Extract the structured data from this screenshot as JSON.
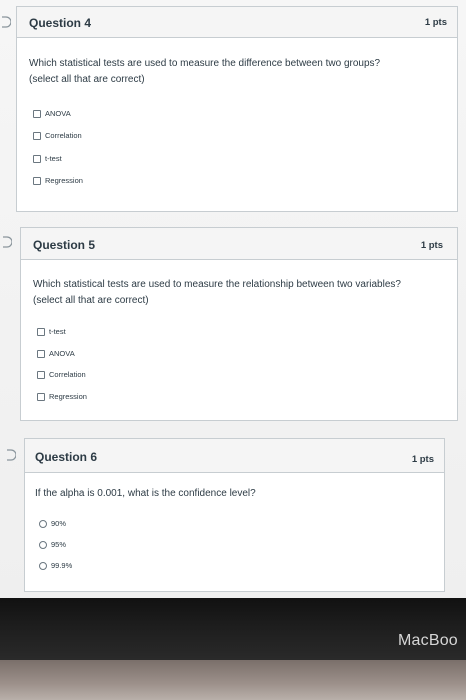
{
  "questions": [
    {
      "title": "Question 4",
      "points": "1 pts",
      "text_line1": "Which statistical tests are used to measure the difference between two groups?",
      "text_line2": "(select all that are correct)",
      "options": [
        "ANOVA",
        "Correlation",
        "t-test",
        "Regression"
      ]
    },
    {
      "title": "Question 5",
      "points": "1 pts",
      "text_line1": "Which statistical tests are used to measure the relationship between two variables?",
      "text_line2": "(select all that are correct)",
      "options": [
        "t-test",
        "ANOVA",
        "Correlation",
        "Regression"
      ]
    },
    {
      "title": "Question 6",
      "points": "1 pts",
      "text_line1": "If the alpha is 0.001, what is the confidence level?",
      "options": [
        "90%",
        "95%",
        "99.9%"
      ]
    }
  ],
  "device": {
    "brand": "MacBoo"
  },
  "colors": {
    "border": "#c7cdd1",
    "header_bg": "#f5f5f5",
    "text": "#2d3b45"
  }
}
